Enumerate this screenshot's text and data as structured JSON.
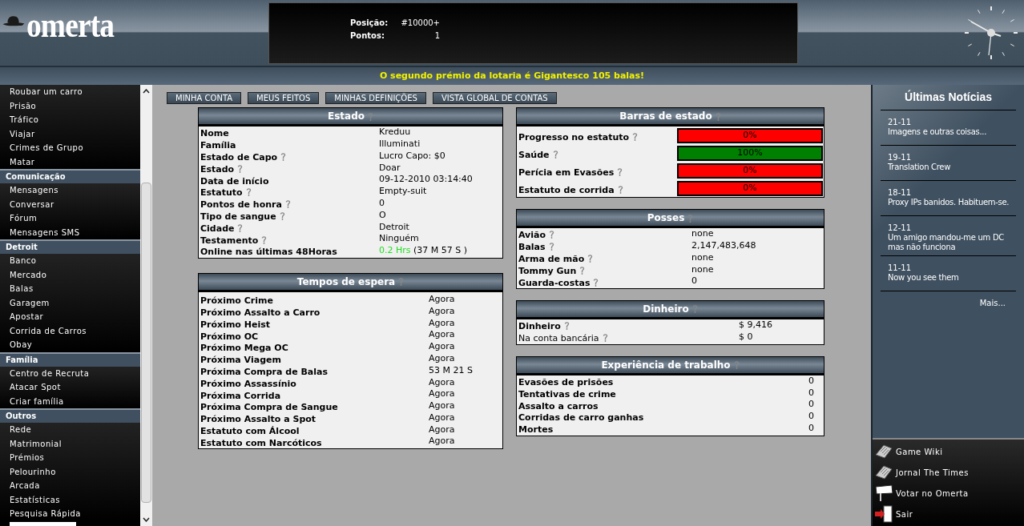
{
  "header": {
    "logo": "omerta",
    "stats": [
      {
        "label": "Posição:",
        "value": "#10000+"
      },
      {
        "label": "Pontos:",
        "value": "1"
      }
    ]
  },
  "ticker": "O segundo prémio da lotaria é Gigantesco 105 balas!",
  "sidebar": {
    "sections": [
      {
        "items": [
          "Roubar um carro",
          "Prisão",
          "Tráfico",
          "Viajar",
          "Crimes de Grupo",
          "Matar"
        ]
      },
      {
        "title": "Comunicação",
        "items": [
          "Mensagens",
          "Conversar",
          "Fórum",
          "Mensagens SMS"
        ]
      },
      {
        "title": "Detroit",
        "items": [
          "Banco",
          "Mercado",
          "Balas",
          "Garagem",
          "Apostar",
          "Corrida de Carros",
          "Obay"
        ]
      },
      {
        "title": "Família",
        "items": [
          "Centro de Recruta",
          "Atacar Spot",
          "Criar família"
        ]
      },
      {
        "title": "Outros",
        "items": [
          "Rede",
          "Matrimonial",
          "Prémios",
          "Pelourinho",
          "Arcada",
          "Estatísticas",
          "Pesquisa Rápida"
        ]
      }
    ]
  },
  "tabs": [
    {
      "label": "MINHA CONTA",
      "selected": false
    },
    {
      "label": "MEUS FEITOS",
      "selected": false
    },
    {
      "label": "MINHAS DEFINIÇÕES",
      "selected": false
    },
    {
      "label": "VISTA GLOBAL DE CONTAS",
      "selected": false
    }
  ],
  "estado": {
    "title": "Estado",
    "rows": [
      {
        "label": "Nome",
        "value": "Kreduu",
        "help": false
      },
      {
        "label": "Família",
        "value": "Illuminati",
        "help": false
      },
      {
        "label": "Estado de Capo",
        "value": "Lucro Capo: $0",
        "help": true
      },
      {
        "label": "Estado",
        "value": "Doar",
        "help": true
      },
      {
        "label": "Data de início",
        "value": "09-12-2010 03:14:40",
        "help": false
      },
      {
        "label": "Estatuto",
        "value": "Empty-suit",
        "help": true
      },
      {
        "label": "Pontos de honra",
        "value": "0",
        "help": true
      },
      {
        "label": "Tipo de sangue",
        "value": "O",
        "help": true
      },
      {
        "label": "Cidade",
        "value": "Detroit",
        "help": true
      },
      {
        "label": "Testamento",
        "value": "Ninguém",
        "help": true
      },
      {
        "label": "Online nas últimas 48Horas",
        "value_highlight": "0.2 Hrs",
        "value": "(37 M 57 S )",
        "help": false
      }
    ]
  },
  "tempos": {
    "title": "Tempos de espera",
    "rows": [
      {
        "label": "Próximo Crime",
        "value": "Agora"
      },
      {
        "label": "Próximo Assalto a Carro",
        "value": "Agora"
      },
      {
        "label": "Próximo Heist",
        "value": "Agora"
      },
      {
        "label": "Próximo OC",
        "value": "Agora"
      },
      {
        "label": "Próximo Mega OC",
        "value": "Agora"
      },
      {
        "label": "Próxima Viagem",
        "value": "Agora"
      },
      {
        "label": "Próxima Compra de Balas",
        "value": "53 M 21 S"
      },
      {
        "label": "Próximo Assassínio",
        "value": "Agora"
      },
      {
        "label": "Próxima Corrida",
        "value": "Agora"
      },
      {
        "label": "Próxima Compra de Sangue",
        "value": "Agora"
      },
      {
        "label": "Próximo Assalto a Spot",
        "value": "Agora"
      },
      {
        "label": "Estatuto com Álcool",
        "value": "Agora"
      },
      {
        "label": "Estatuto com Narcóticos",
        "value": "Agora"
      }
    ]
  },
  "barras": {
    "title": "Barras de estado",
    "rows": [
      {
        "label": "Progresso no estatuto",
        "level": 0,
        "reading": "0%"
      },
      {
        "label": "Saúde",
        "level": 1,
        "reading": "100%"
      },
      {
        "label": "Perícia em Evasões",
        "level": 0,
        "reading": "0%"
      },
      {
        "label": "Estatuto de corrida",
        "level": 0,
        "reading": "0%"
      }
    ]
  },
  "posses": {
    "title": "Posses",
    "rows": [
      {
        "label": "Avião",
        "value": "none",
        "help": true
      },
      {
        "label": "Balas",
        "value": "2,147,483,648",
        "help": true
      },
      {
        "label": "Arma de mão",
        "value": "none",
        "help": true
      },
      {
        "label": "Tommy Gun",
        "value": "none",
        "help": true
      },
      {
        "label": "Guarda-costas",
        "value": "0",
        "help": true
      }
    ]
  },
  "dinheiro": {
    "title": "Dinheiro",
    "rows": [
      {
        "label": "Dinheiro",
        "value": "$ 9,416",
        "help": true,
        "bold": true
      },
      {
        "label": "Na conta bancária",
        "value": "$ 0",
        "help": true,
        "bold": false
      }
    ]
  },
  "experiencia": {
    "title": "Experiência de trabalho",
    "rows": [
      {
        "label": "Evasões de prisões",
        "value": "0"
      },
      {
        "label": "Tentativas de crime",
        "value": "0"
      },
      {
        "label": "Assalto a carros",
        "value": "0"
      },
      {
        "label": "Corridas de carro ganhas",
        "value": "0"
      },
      {
        "label": "Mortes",
        "value": "0"
      }
    ]
  },
  "news": {
    "title": "Últimas Notícias",
    "items": [
      {
        "date": "21-11",
        "text": "Imagens e outras coisas..."
      },
      {
        "date": "19-11",
        "text": "Translation Crew"
      },
      {
        "date": "18-11",
        "text": "Proxy IPs banidos. Habituem-se."
      },
      {
        "date": "12-11",
        "text": "Um amigo mandou-me um DC mas não funciona"
      },
      {
        "date": "11-11",
        "text": "Now you see them"
      }
    ],
    "more": "Mais..."
  },
  "links": [
    {
      "kind": "newspaper",
      "label": "Game Wiki"
    },
    {
      "kind": "newspaper",
      "label": "Jornal The Times"
    },
    {
      "kind": "vote",
      "label": "Votar no Omerta"
    },
    {
      "kind": "exit",
      "label": "Sair"
    }
  ]
}
